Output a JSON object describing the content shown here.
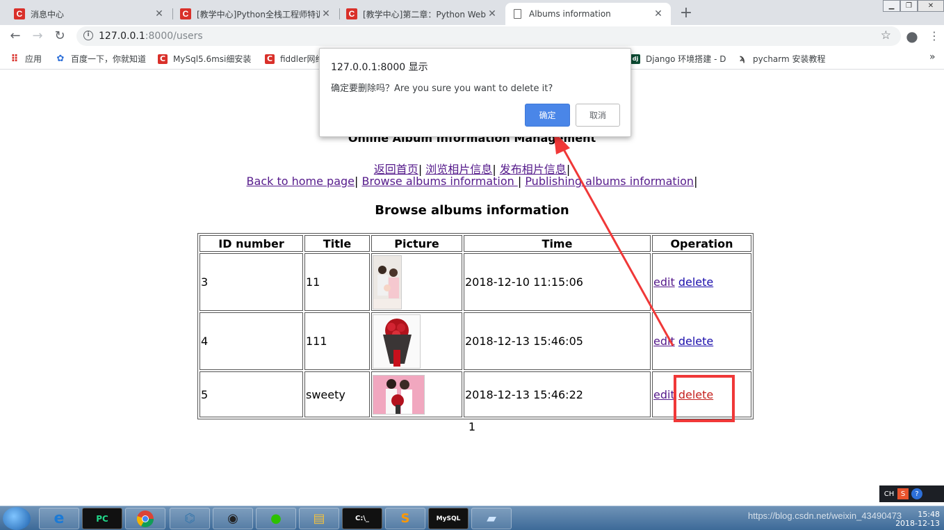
{
  "browser": {
    "tabs": [
      {
        "title": "消息中心",
        "icon": "csdn-icon",
        "active": false
      },
      {
        "title": "[教学中心]Python全栈工程师特训",
        "icon": "csdn-icon",
        "active": false
      },
      {
        "title": "[教学中心]第二章：Python Web",
        "icon": "csdn-icon",
        "active": false
      },
      {
        "title": "Albums information",
        "icon": "page-icon",
        "active": true
      }
    ],
    "close_glyph": "✕",
    "new_tab_glyph": "+",
    "url_host": "127.0.0.1",
    "url_path": ":8000/users",
    "bookmarks": [
      {
        "label": "应用",
        "icon": "apps-icon"
      },
      {
        "label": "百度一下，你就知道",
        "icon": "baidu-icon"
      },
      {
        "label": "MySql5.6msi细安装",
        "icon": "csdn-icon"
      },
      {
        "label": "fiddler网络",
        "icon": "csdn-icon"
      },
      {
        "label": "Django 环境搭建 - D",
        "icon": "django-icon"
      },
      {
        "label": "pycharm 安装教程",
        "icon": "pycharm-icon"
      }
    ],
    "more_glyph": "»"
  },
  "page": {
    "site_title": "Online Album Information Management",
    "nav_cn": [
      "返回首页",
      "浏览相片信息",
      "发布相片信息"
    ],
    "nav_en": [
      "Back to home page",
      "Browse albums information ",
      "Publishing albums information"
    ],
    "separator": "|",
    "heading": "Browse albums information",
    "table": {
      "headers": [
        "ID number",
        "Title",
        "Picture",
        "Time",
        "Operation"
      ],
      "rows": [
        {
          "id": "3",
          "title": "11",
          "time": "2018-12-10 11:15:06",
          "edit": "edit",
          "delete": "delete"
        },
        {
          "id": "4",
          "title": "111",
          "time": "2018-12-13 15:46:05",
          "edit": "edit",
          "delete": "delete"
        },
        {
          "id": "5",
          "title": "sweety",
          "time": "2018-12-13 15:46:22",
          "edit": "edit",
          "delete": "delete"
        }
      ]
    },
    "pager": "1"
  },
  "dialog": {
    "title": "127.0.0.1:8000 显示",
    "message": "确定要删除吗？Are you sure you want to delete it?",
    "ok_label": "确定",
    "cancel_label": "取消"
  },
  "annotation": {
    "color": "#f03838"
  },
  "taskbar": {
    "items": [
      "ie-icon",
      "pycharm-icon",
      "chrome-icon",
      "python-icon",
      "app-icon",
      "wechat-icon",
      "explorer-icon",
      "cmd-icon",
      "sublime-icon",
      "mysql-icon",
      "notepad-icon"
    ],
    "tray": [
      "CH",
      "S",
      "?"
    ],
    "watermark": "https://blog.csdn.net/weixin_43490473",
    "clock_time": "15:48",
    "clock_date": "2018-12-13"
  }
}
